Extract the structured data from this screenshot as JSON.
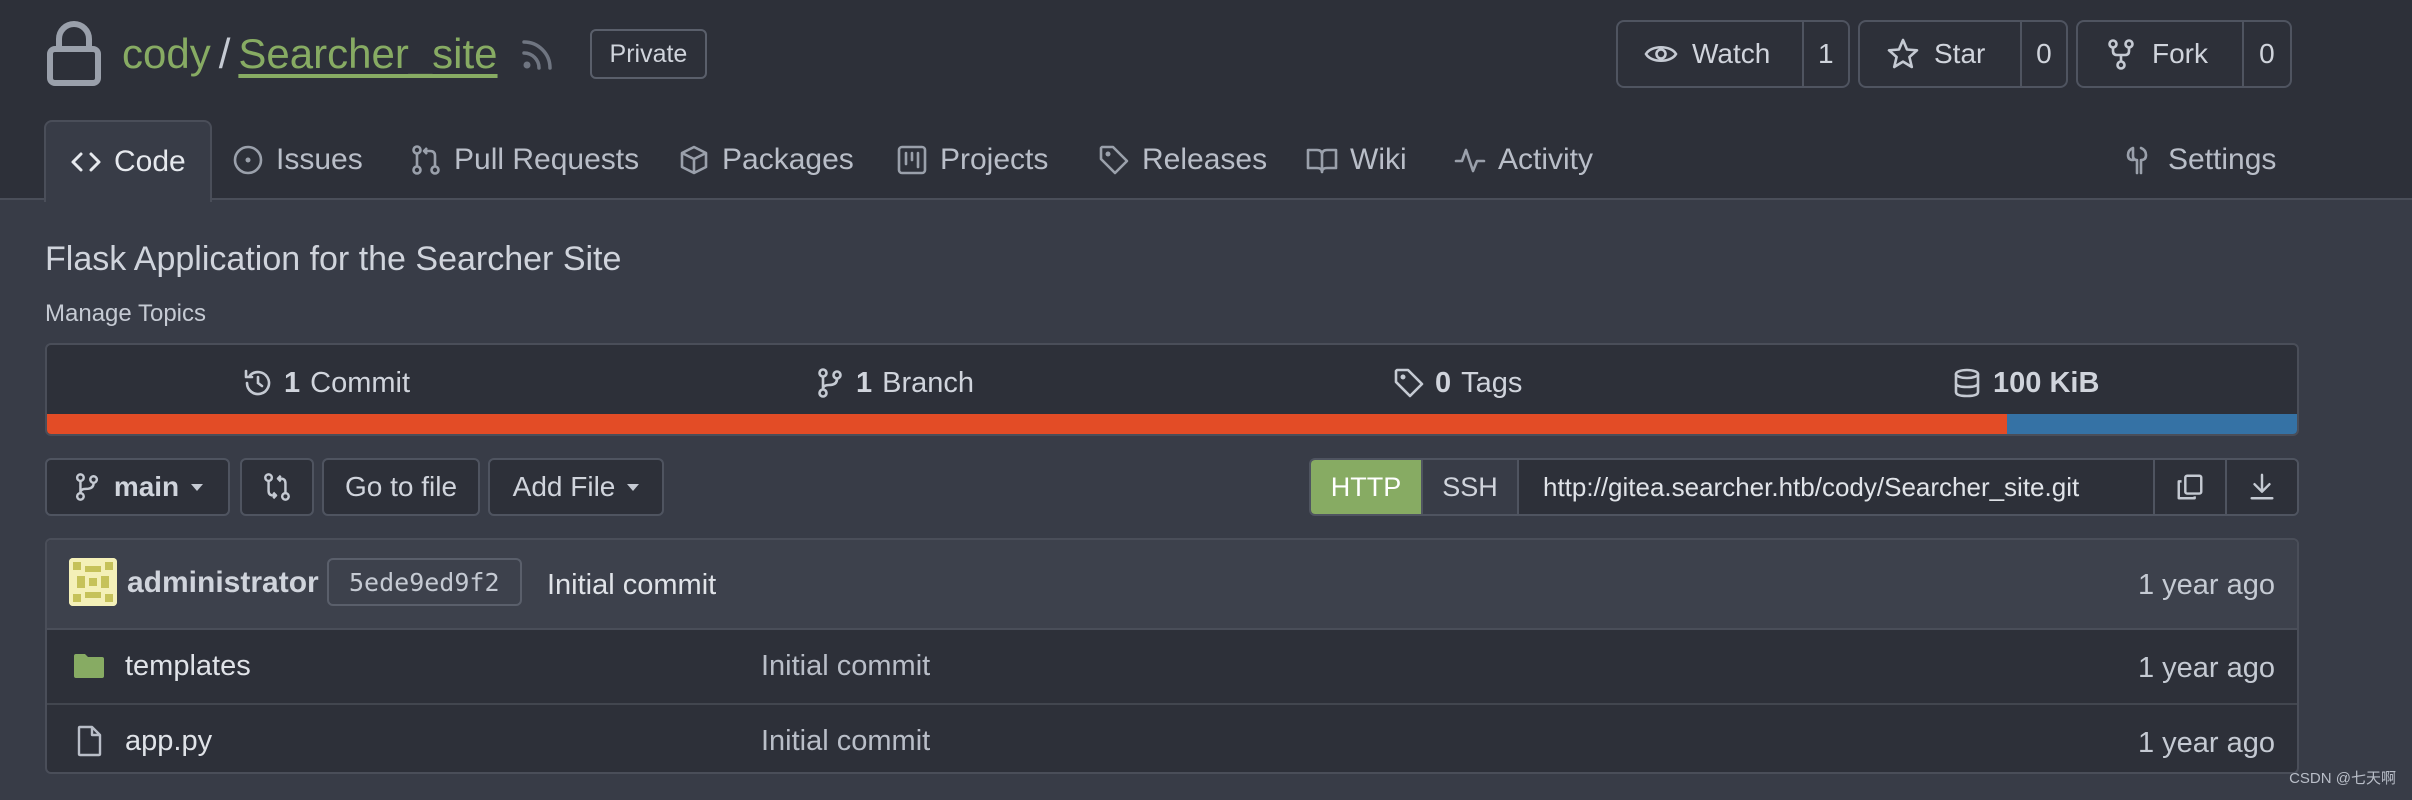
{
  "repo": {
    "owner": "cody",
    "separator": "/",
    "name": "Searcher_site",
    "visibility": "Private",
    "description": "Flask Application for the Searcher Site",
    "manage_topics": "Manage Topics"
  },
  "actions": {
    "watch": {
      "label": "Watch",
      "count": "1"
    },
    "star": {
      "label": "Star",
      "count": "0"
    },
    "fork": {
      "label": "Fork",
      "count": "0"
    }
  },
  "tabs": [
    {
      "label": "Code",
      "icon": "code-icon",
      "active": true
    },
    {
      "label": "Issues",
      "icon": "issue-icon"
    },
    {
      "label": "Pull Requests",
      "icon": "pull-request-icon"
    },
    {
      "label": "Packages",
      "icon": "package-icon"
    },
    {
      "label": "Projects",
      "icon": "project-icon"
    },
    {
      "label": "Releases",
      "icon": "tag-icon"
    },
    {
      "label": "Wiki",
      "icon": "book-icon"
    },
    {
      "label": "Activity",
      "icon": "pulse-icon"
    },
    {
      "label": "Settings",
      "icon": "tools-icon"
    }
  ],
  "stats": {
    "commits": {
      "count": "1",
      "label": "Commit"
    },
    "branches": {
      "count": "1",
      "label": "Branch"
    },
    "tags": {
      "count": "0",
      "label": "Tags"
    },
    "size": "100 KiB"
  },
  "language_bar": [
    {
      "percent": 87.1,
      "color": "#e34c26"
    },
    {
      "percent": 12.9,
      "color": "#3572a5"
    }
  ],
  "toolbar": {
    "branch": "main",
    "go_to_file": "Go to file",
    "add_file": "Add File"
  },
  "clone": {
    "http_label": "HTTP",
    "ssh_label": "SSH",
    "url": "http://gitea.searcher.htb/cody/Searcher_site.git"
  },
  "latest_commit": {
    "author": "administrator",
    "sha": "5ede9ed9f2",
    "message": "Initial commit",
    "age": "1 year ago"
  },
  "files": [
    {
      "name": "templates",
      "type": "folder",
      "commit": "Initial commit",
      "age": "1 year ago"
    },
    {
      "name": "app.py",
      "type": "file",
      "commit": "Initial commit",
      "age": "1 year ago"
    }
  ],
  "watermark": "CSDN @七天啊",
  "colors": {
    "accent": "#87ab63",
    "header_bg": "#2d3039",
    "page_bg": "#383c47"
  }
}
